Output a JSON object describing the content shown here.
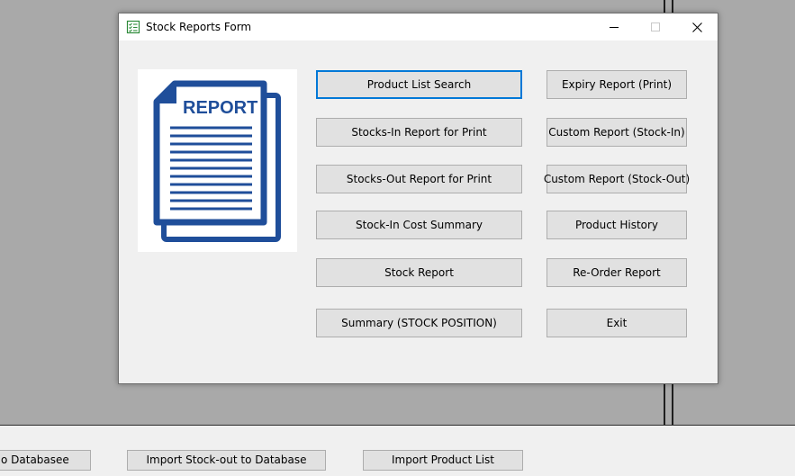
{
  "dialog": {
    "title": "Stock Reports Form",
    "buttons_left": [
      {
        "label": "Product List Search",
        "focused": true
      },
      {
        "label": "Stocks-In Report for Print"
      },
      {
        "label": "Stocks-Out Report for Print"
      },
      {
        "label": "Stock-In Cost Summary"
      },
      {
        "label": "Stock Report"
      },
      {
        "label": "Summary (STOCK POSITION)"
      }
    ],
    "buttons_right": [
      {
        "label": "Expiry Report (Print)"
      },
      {
        "label": "Custom Report (Stock-In)"
      },
      {
        "label": "Custom Report (Stock-Out)"
      },
      {
        "label": "Product History"
      },
      {
        "label": "Re-Order Report"
      },
      {
        "label": "Exit"
      }
    ],
    "report_image_text": "REPORT"
  },
  "background": {
    "buttons": [
      "o Databasee",
      "Import Stock-out to Database",
      "Import Product List"
    ]
  },
  "colors": {
    "report_blue": "#1f4e9a",
    "focus_border": "#0078d7",
    "button_face": "#e1e1e1",
    "parent_gray": "#a9a9a9"
  }
}
